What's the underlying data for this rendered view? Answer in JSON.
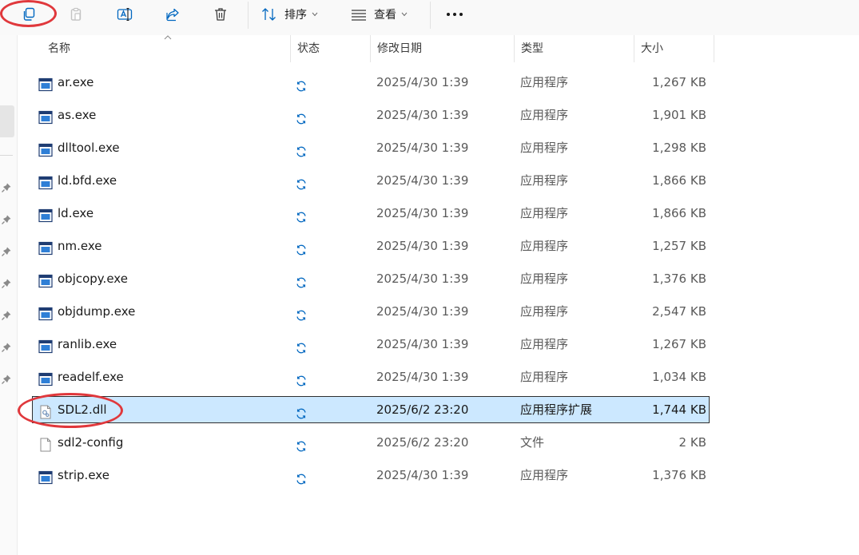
{
  "toolbar": {
    "sort_label": "排序",
    "view_label": "查看"
  },
  "columns": {
    "name": "名称",
    "status": "状态",
    "date": "修改日期",
    "type": "类型",
    "size": "大小"
  },
  "files": [
    {
      "name": "ar.exe",
      "icon": "exe",
      "date": "2025/4/30 1:39",
      "type": "应用程序",
      "size": "1,267 KB"
    },
    {
      "name": "as.exe",
      "icon": "exe",
      "date": "2025/4/30 1:39",
      "type": "应用程序",
      "size": "1,901 KB"
    },
    {
      "name": "dlltool.exe",
      "icon": "exe",
      "date": "2025/4/30 1:39",
      "type": "应用程序",
      "size": "1,298 KB"
    },
    {
      "name": "ld.bfd.exe",
      "icon": "exe",
      "date": "2025/4/30 1:39",
      "type": "应用程序",
      "size": "1,866 KB"
    },
    {
      "name": "ld.exe",
      "icon": "exe",
      "date": "2025/4/30 1:39",
      "type": "应用程序",
      "size": "1,866 KB"
    },
    {
      "name": "nm.exe",
      "icon": "exe",
      "date": "2025/4/30 1:39",
      "type": "应用程序",
      "size": "1,257 KB"
    },
    {
      "name": "objcopy.exe",
      "icon": "exe",
      "date": "2025/4/30 1:39",
      "type": "应用程序",
      "size": "1,376 KB"
    },
    {
      "name": "objdump.exe",
      "icon": "exe",
      "date": "2025/4/30 1:39",
      "type": "应用程序",
      "size": "2,547 KB"
    },
    {
      "name": "ranlib.exe",
      "icon": "exe",
      "date": "2025/4/30 1:39",
      "type": "应用程序",
      "size": "1,267 KB"
    },
    {
      "name": "readelf.exe",
      "icon": "exe",
      "date": "2025/4/30 1:39",
      "type": "应用程序",
      "size": "1,034 KB"
    },
    {
      "name": "SDL2.dll",
      "icon": "dll",
      "date": "2025/6/2 23:20",
      "type": "应用程序扩展",
      "size": "1,744 KB",
      "selected": true
    },
    {
      "name": "sdl2-config",
      "icon": "file",
      "date": "2025/6/2 23:20",
      "type": "文件",
      "size": "2 KB"
    },
    {
      "name": "strip.exe",
      "icon": "exe",
      "date": "2025/4/30 1:39",
      "type": "应用程序",
      "size": "1,376 KB"
    }
  ],
  "colors": {
    "selection_bg": "#cce8ff",
    "accent": "#0067c0",
    "annotation": "#e0383c"
  }
}
